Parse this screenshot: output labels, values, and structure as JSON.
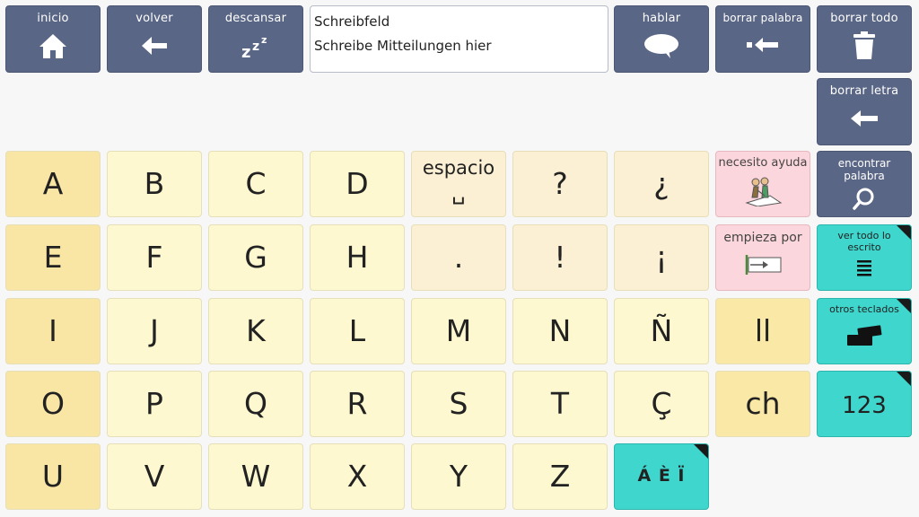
{
  "toolbar": {
    "inicio": "inicio",
    "volver": "volver",
    "descansar": "descansar",
    "hablar": "hablar",
    "borrar_palabra": "borrar palabra",
    "borrar_todo": "borrar todo",
    "borrar_letra": "borrar letra"
  },
  "textbox": {
    "line1": "Schreibfeld",
    "line2": "Schreibe Mitteilungen hier"
  },
  "keys": {
    "A": "A",
    "B": "B",
    "C": "C",
    "D": "D",
    "espacio": "espacio",
    "espacio_symbol": "␣",
    "question": "?",
    "inv_question": "¿",
    "E": "E",
    "F": "F",
    "G": "G",
    "H": "H",
    "period": ".",
    "exclaim": "!",
    "inv_exclaim": "¡",
    "I": "I",
    "J": "J",
    "K": "K",
    "L": "L",
    "M": "M",
    "N": "N",
    "N_tilde": "Ñ",
    "ll": "ll",
    "O": "O",
    "P": "P",
    "Q": "Q",
    "R": "R",
    "S": "S",
    "T": "T",
    "C_cedilla": "Ç",
    "ch": "ch",
    "U": "U",
    "V": "V",
    "W": "W",
    "X": "X",
    "Y": "Y",
    "Z": "Z",
    "accents": "Á È Ï"
  },
  "side": {
    "necesito_ayuda": "necesito ayuda",
    "empieza_por": "empieza por",
    "encontrar_palabra": "encontrar palabra",
    "ver_todo": "ver todo lo escrito",
    "otros_teclados": "otros teclados",
    "numbers": "123"
  },
  "icons": {
    "inicio": "home-icon",
    "volver": "arrow-left-icon",
    "descansar": "sleep-zzz-icon",
    "hablar": "speech-bubble-icon",
    "borrar_palabra": "delete-word-icon",
    "borrar_todo": "trash-icon",
    "borrar_letra": "backspace-arrow-icon",
    "encontrar_palabra": "magnifier-icon",
    "ver_todo": "text-lines-icon",
    "otros_teclados": "keyboards-icon",
    "necesito_ayuda": "help-pictogram-icon",
    "empieza_por": "starts-with-pictogram-icon"
  },
  "colors": {
    "nav": "#5a6685",
    "vowel": "#f9e6a4",
    "consonant": "#fdf8d0",
    "punctuation": "#fbf0d4",
    "pink": "#fbd6dc",
    "teal": "#3fd6cd"
  }
}
